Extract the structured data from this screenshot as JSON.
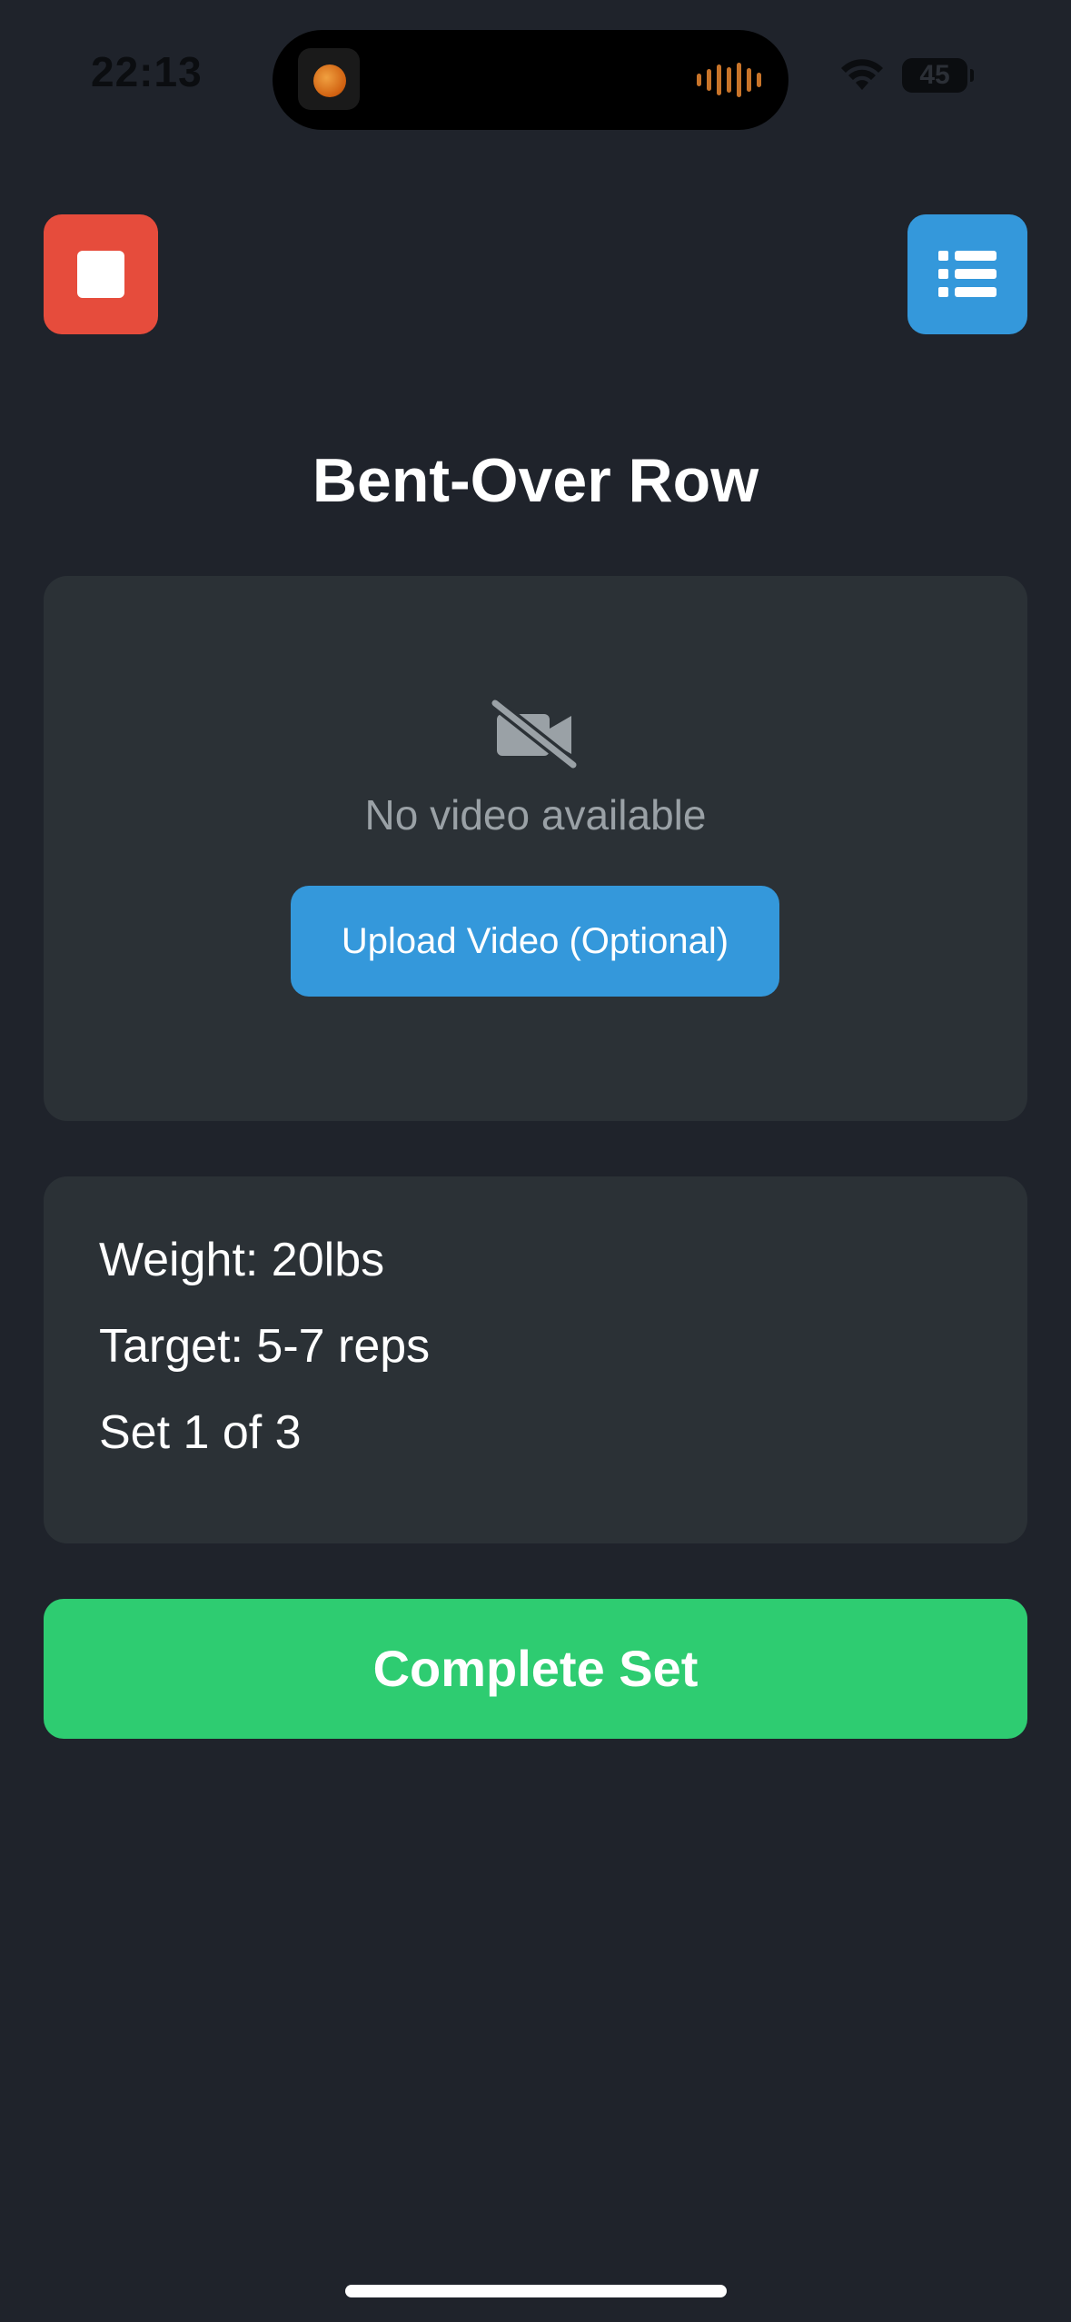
{
  "status_bar": {
    "time": "22:13",
    "battery": "45"
  },
  "header": {
    "stop_icon": "stop-icon",
    "list_icon": "list-icon"
  },
  "exercise": {
    "title": "Bent-Over Row"
  },
  "video": {
    "icon": "video-off-icon",
    "empty_text": "No video available",
    "upload_label": "Upload Video (Optional)"
  },
  "details": {
    "weight": "Weight: 20lbs",
    "target": "Target: 5-7 reps",
    "set": "Set 1 of 3"
  },
  "actions": {
    "complete_label": "Complete Set"
  },
  "colors": {
    "background": "#1f232b",
    "card": "#2b3136",
    "stop": "#e64c3c",
    "accent_blue": "#3498db",
    "success_green": "#2ecc71"
  }
}
